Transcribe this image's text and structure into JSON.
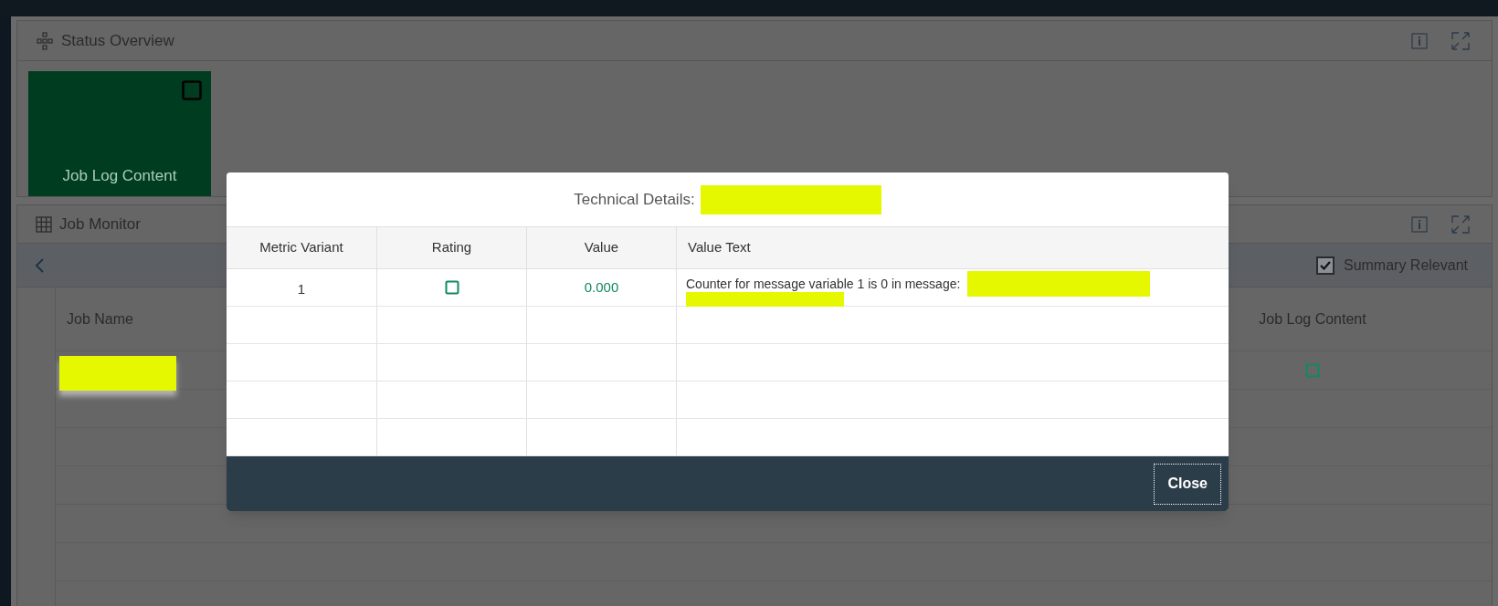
{
  "status_overview": {
    "title": "Status Overview",
    "tiles": [
      {
        "label": "Job Log Content"
      }
    ]
  },
  "job_monitor": {
    "title": "Job Monitor",
    "summary_relevant": {
      "label": "Summary Relevant",
      "checked": true
    },
    "columns": [
      "Job Name",
      "Job Log Content"
    ]
  },
  "dialog": {
    "title": "Technical Details:",
    "columns": [
      "Metric Variant",
      "Rating",
      "Value",
      "Value Text"
    ],
    "rows": [
      {
        "metric_variant": "1",
        "value": "0.000",
        "value_text": "Counter for message variable 1 is 0 in message:"
      }
    ],
    "buttons": [
      {
        "label": "Close"
      }
    ]
  }
}
